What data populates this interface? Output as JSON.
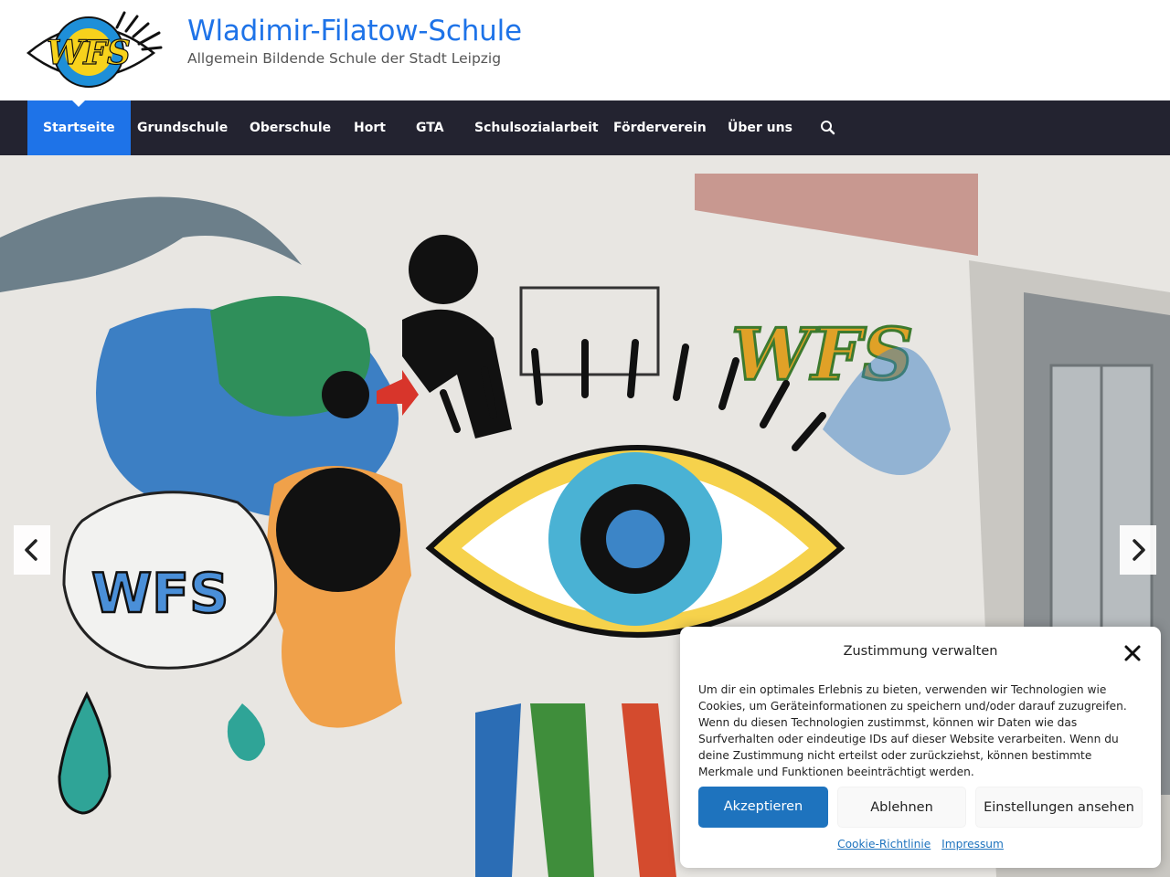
{
  "header": {
    "logo_text": "WFS",
    "site_title": "Wladimir-Filatow-Schule",
    "site_description": "Allgemein Bildende Schule der Stadt Leipzig"
  },
  "nav": {
    "items": [
      {
        "label": "Startseite",
        "active": true
      },
      {
        "label": "Grundschule",
        "active": false
      },
      {
        "label": "Oberschule",
        "active": false
      },
      {
        "label": "Hort",
        "active": false
      },
      {
        "label": "GTA",
        "active": false
      },
      {
        "label": "Schulsozialarbeit",
        "active": false
      },
      {
        "label": "Förderverein",
        "active": false
      },
      {
        "label": "Über uns",
        "active": false
      }
    ],
    "search_icon": "search-icon"
  },
  "hero": {
    "mural_text_1": "WFS",
    "mural_text_2": "WFS",
    "prev_icon": "chevron-left-icon",
    "next_icon": "chevron-right-icon"
  },
  "cookie_banner": {
    "title": "Zustimmung verwalten",
    "close_icon": "close-icon",
    "text": "Um dir ein optimales Erlebnis zu bieten, verwenden wir Technologien wie Cookies, um Geräteinformationen zu speichern und/oder darauf zuzugreifen. Wenn du diesen Technologien zustimmst, können wir Daten wie das Surfverhalten oder eindeutige IDs auf dieser Website verarbeiten. Wenn du deine Zustimmung nicht erteilst oder zurückziehst, können bestimmte Merkmale und Funktionen beeinträchtigt werden.",
    "accept_label": "Akzeptieren",
    "deny_label": "Ablehnen",
    "settings_label": "Einstellungen ansehen",
    "links": [
      "Cookie-Richtlinie",
      "Impressum"
    ]
  },
  "colors": {
    "accent": "#1e73e8",
    "nav_bg": "#232330",
    "button_primary": "#1e73be"
  }
}
